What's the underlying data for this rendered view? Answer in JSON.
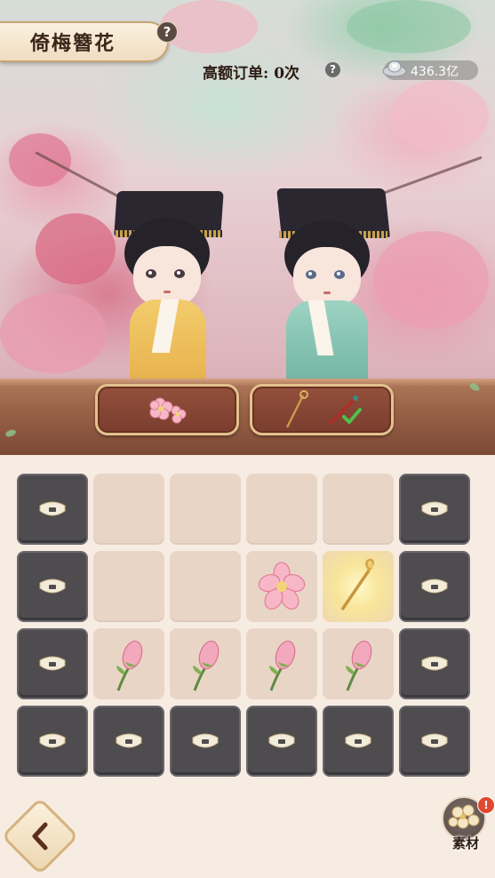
{
  "header": {
    "title": "倚梅簪花",
    "help_glyph": "?",
    "high_orders_label": "高额订单:",
    "high_orders_count": "0次",
    "high_orders_help_glyph": "?",
    "currency_icon": "silver-ingot-icon",
    "currency_value": "436.3亿"
  },
  "orders": [
    {
      "character": "yellow-robed-lady",
      "items": [
        "plum-blossom-icon"
      ],
      "fulfilled": false
    },
    {
      "character": "teal-robed-lady",
      "items": [
        "hairpin-icon",
        "tassel-icon"
      ],
      "fulfilled": true
    }
  ],
  "board": {
    "rows": 4,
    "cols": 6,
    "cells": [
      [
        "locked",
        "empty",
        "empty",
        "empty",
        "empty",
        "locked"
      ],
      [
        "locked",
        "empty",
        "empty",
        "plum-flower",
        "golden-hairpin",
        "locked"
      ],
      [
        "locked",
        "plum-bud",
        "plum-bud",
        "plum-bud",
        "plum-bud",
        "locked"
      ],
      [
        "locked",
        "locked",
        "locked",
        "locked",
        "locked",
        "locked"
      ]
    ]
  },
  "footer": {
    "back_icon": "chevron-left-icon",
    "material_label": "素材",
    "material_notification": "!"
  },
  "colors": {
    "locked_cell": "#4e4c4f",
    "empty_cell": "#e9d5c6",
    "shelf_wood": "#9a6247",
    "order_slot": "#7a3d2e"
  }
}
